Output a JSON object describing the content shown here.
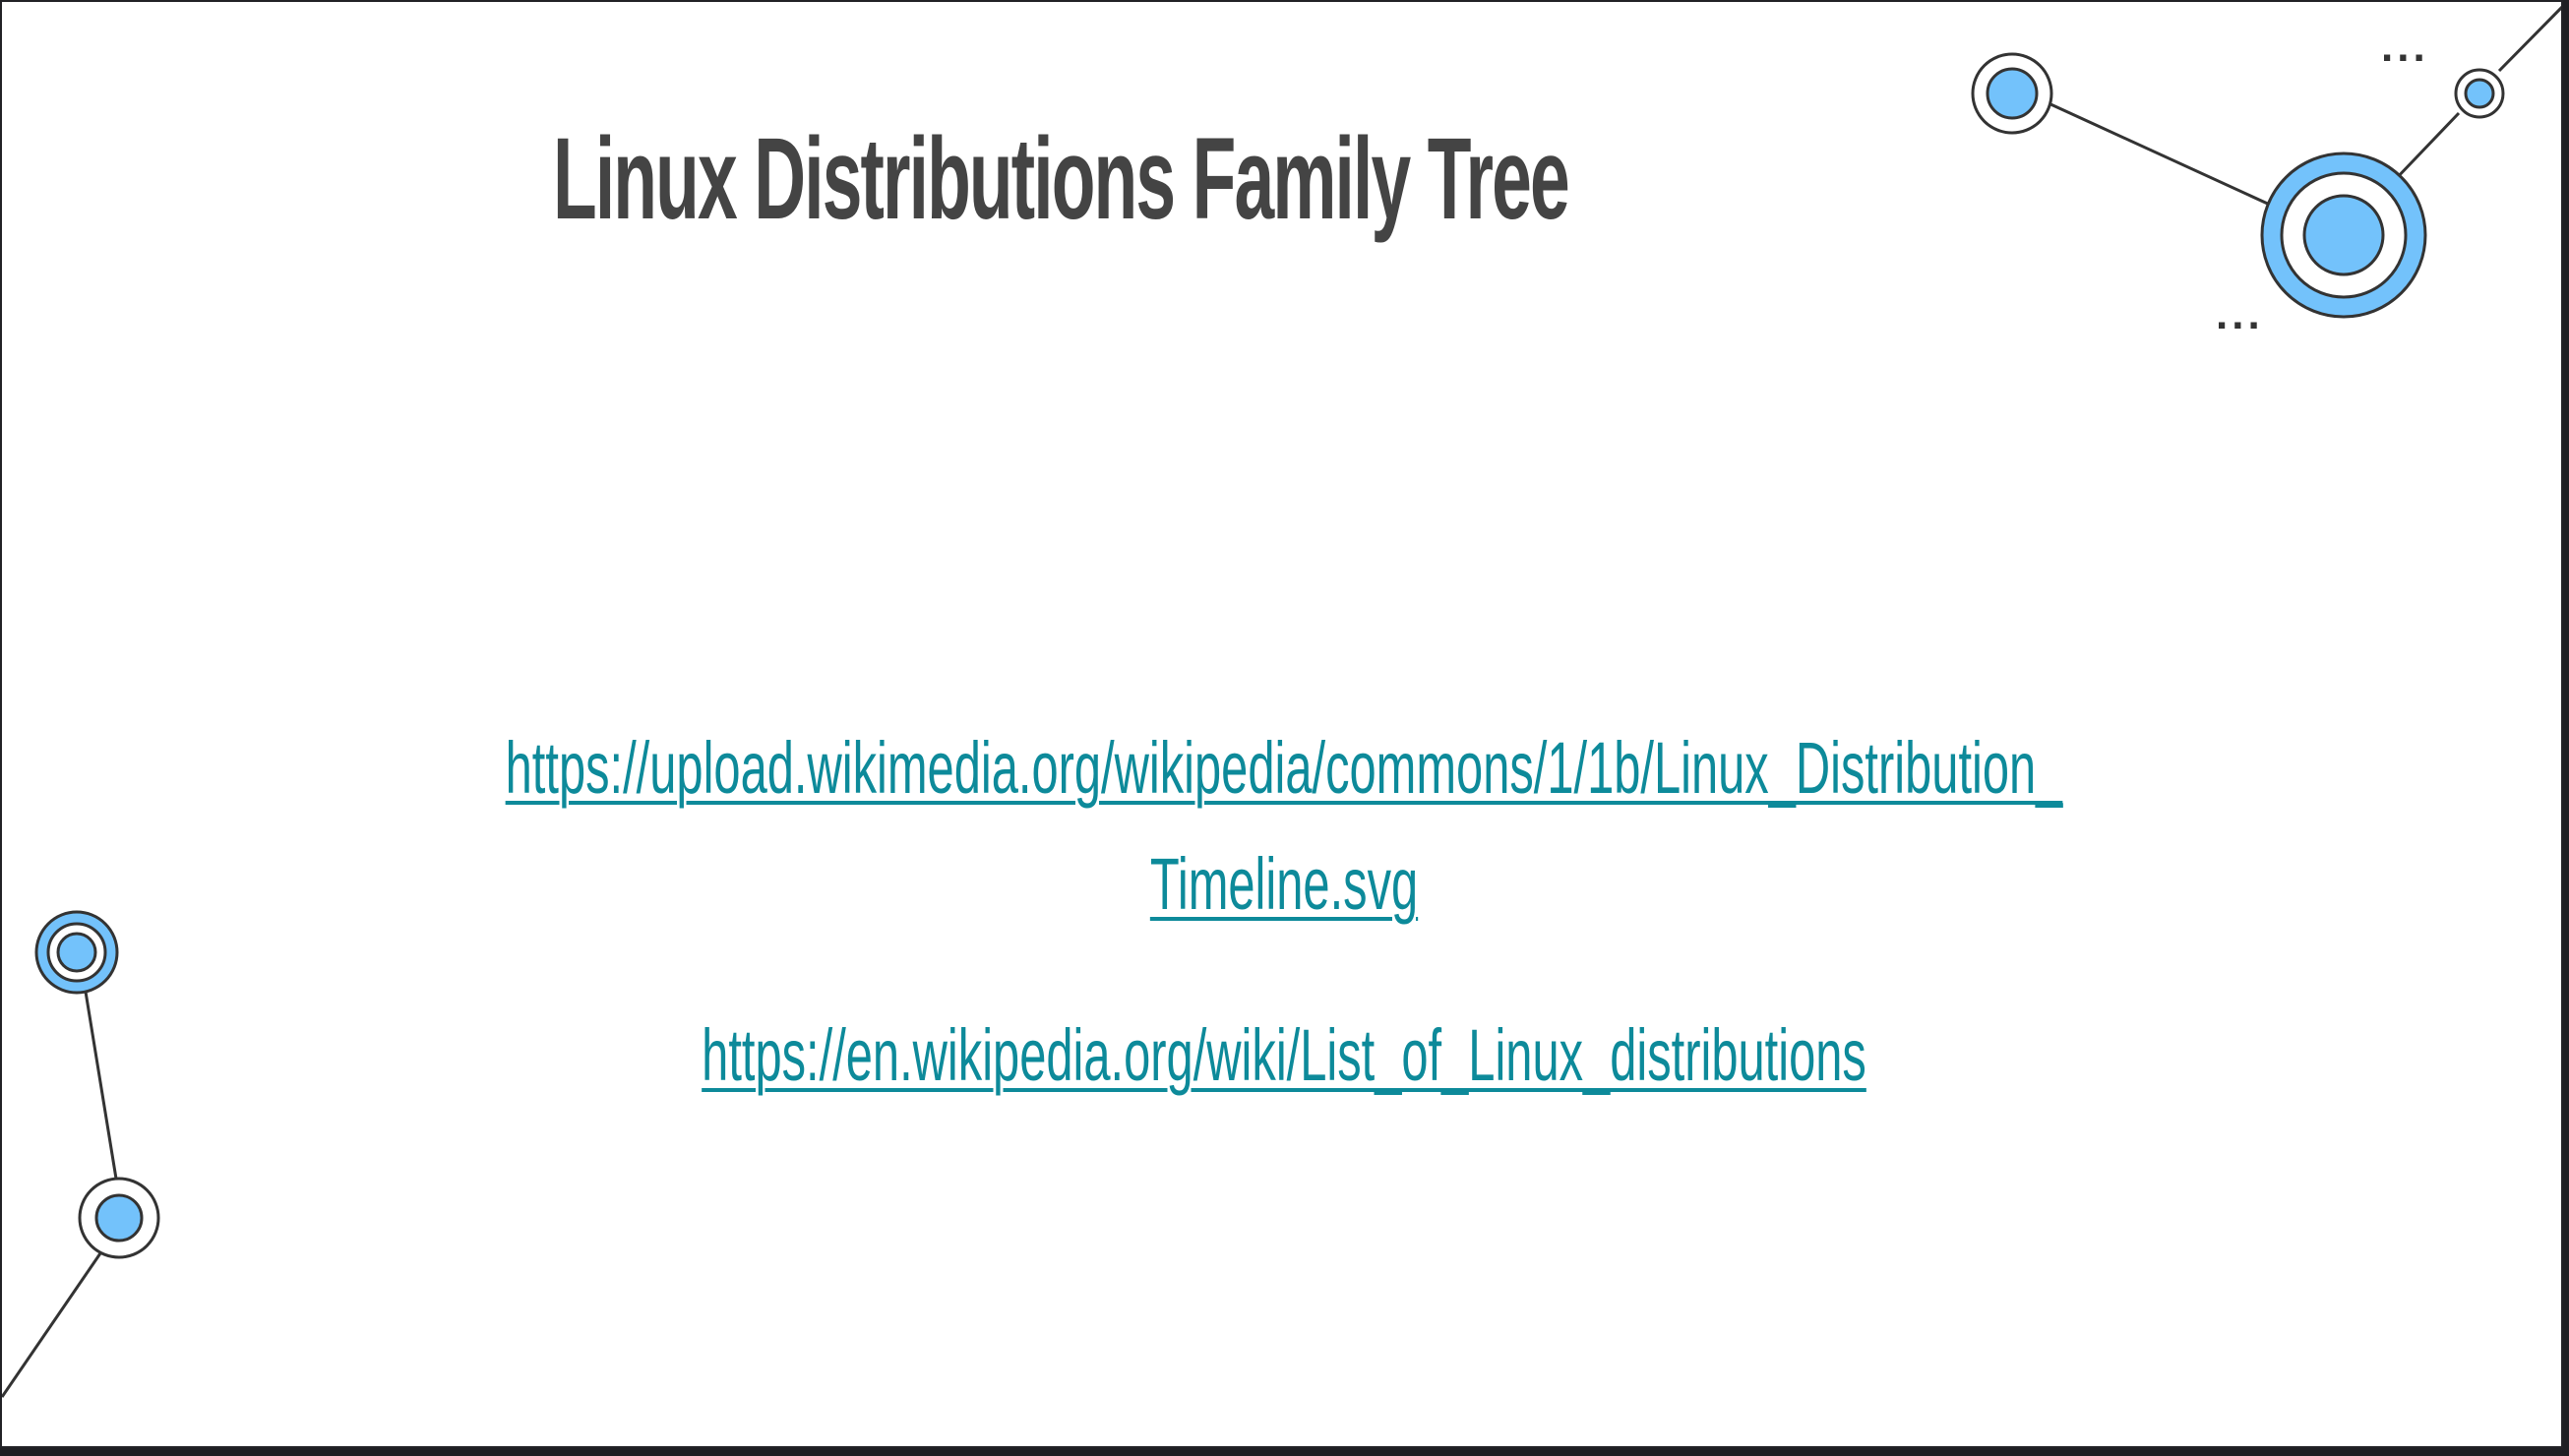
{
  "slide": {
    "title": "Linux Distributions Family Tree",
    "links": [
      {
        "line1": "https://upload.wikimedia.org/wikipedia/commons/1/1b/Linux_Distribution_",
        "line2": "Timeline.svg"
      },
      {
        "line1": "https://en.wikipedia.org/wiki/List_of_Linux_distributions"
      }
    ],
    "decoration": {
      "ellipsis_top": "...",
      "ellipsis_bottom": "..."
    }
  },
  "colors": {
    "accent_blue": "#73c2fb",
    "link": "#0d8a9a",
    "title": "#444444",
    "outline": "#333333"
  }
}
